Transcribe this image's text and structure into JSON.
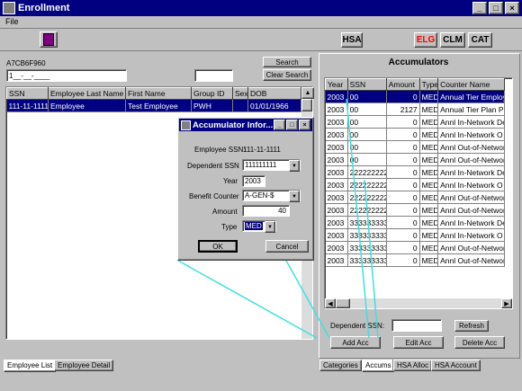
{
  "window": {
    "title": "Enrollment"
  },
  "menu": {
    "file": "File"
  },
  "toolbar": {
    "hsa": "HSA",
    "elg": "ELG",
    "clm": "CLM",
    "cat": "CAT"
  },
  "left": {
    "record_id": "A7CB6F960",
    "ssn_input": "1__-__-____",
    "search": "Search",
    "clear_search": "Clear Search",
    "columns": [
      "SSN",
      "Employee Last Name",
      "First Name",
      "Group ID",
      "Sex",
      "DOB"
    ],
    "rows": [
      [
        "111-11-1111",
        "Employee",
        "Test Employee",
        "PWH",
        "",
        "01/01/1966"
      ]
    ],
    "tabs": [
      "Employee List",
      "Employee Detail"
    ]
  },
  "right": {
    "title": "Accumulators",
    "columns": [
      "Year",
      "SSN",
      "Amount",
      "Type",
      "Counter Name"
    ],
    "rows": [
      [
        "2003",
        "00",
        "0",
        "MED",
        "Annual Tier Employ"
      ],
      [
        "2003",
        "00",
        "2127",
        "MED",
        "Annual Tier Plan P"
      ],
      [
        "2003",
        "00",
        "0",
        "MED",
        "Annl In-Network De"
      ],
      [
        "2003",
        "00",
        "0",
        "MED",
        "Annl In-Network O"
      ],
      [
        "2003",
        "00",
        "0",
        "MED",
        "Annl Out-of-Networ"
      ],
      [
        "2003",
        "00",
        "0",
        "MED",
        "Annl Out-of-Networ"
      ],
      [
        "2003",
        "222222222",
        "0",
        "MED",
        "Annl In-Network De"
      ],
      [
        "2003",
        "222222222",
        "0",
        "MED",
        "Annl In-Network O"
      ],
      [
        "2003",
        "222222222",
        "0",
        "MED",
        "Annl Out-of-Networ"
      ],
      [
        "2003",
        "222222222",
        "0",
        "MED",
        "Annl Out-of-Networ"
      ],
      [
        "2003",
        "333333333",
        "0",
        "MED",
        "Annl In-Network De"
      ],
      [
        "2003",
        "333333333",
        "0",
        "MED",
        "Annl In-Network O"
      ],
      [
        "2003",
        "333333333",
        "0",
        "MED",
        "Annl Out-of-Networ"
      ],
      [
        "2003",
        "333333333",
        "0",
        "MED",
        "Annl Out-of-Networ"
      ]
    ],
    "dependent_ssn_label": "Dependent SSN:",
    "refresh": "Refresh",
    "add_acc": "Add Acc",
    "edit_acc": "Edit Acc",
    "delete_acc": "Delete Acc",
    "tabs": [
      "Categories",
      "Accums",
      "HSA Alloc",
      "HSA Account"
    ]
  },
  "dialog": {
    "title": "Accumulator Infor...",
    "employee_ssn_label": "Employee SSN:",
    "employee_ssn": "111-11-1111",
    "dependent_ssn_label": "Dependent SSN",
    "dependent_ssn": "111111111",
    "year_label": "Year",
    "year": "2003",
    "benefit_counter_label": "Benefit Counter",
    "benefit_counter": "A-GEN-$",
    "amount_label": "Amount",
    "amount": "40",
    "type_label": "Type",
    "type": "MED",
    "ok": "OK",
    "cancel": "Cancel"
  },
  "colors": {
    "titlebar": "#000080",
    "elg_text": "#ff0000",
    "callout_line": "#40e0e0"
  }
}
